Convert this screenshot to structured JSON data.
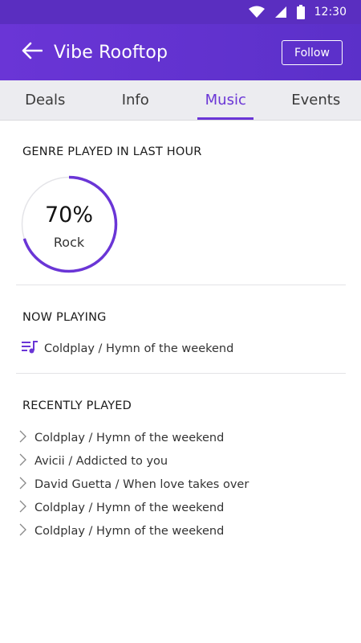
{
  "status_bar": {
    "time": "12:30",
    "icons": [
      "wifi-icon",
      "signal-icon",
      "battery-icon"
    ]
  },
  "app_bar": {
    "title": "Vibe Rooftop",
    "follow_label": "Follow",
    "back_icon": "arrow-left-icon"
  },
  "tabs": [
    {
      "label": "Deals",
      "active": false
    },
    {
      "label": "Info",
      "active": false
    },
    {
      "label": "Music",
      "active": true
    },
    {
      "label": "Events",
      "active": false
    }
  ],
  "genre": {
    "section_title": "GENRE PLAYED IN LAST HOUR",
    "percent_label": "70%",
    "percent": 0.7,
    "genre": "Rock"
  },
  "now_playing": {
    "section_title": "NOW PLAYING",
    "track": "Coldplay / Hymn of the weekend",
    "icon": "queue-music-icon"
  },
  "recently_played": {
    "section_title": "RECENTLY PLAYED",
    "items": [
      "Coldplay /  Hymn of the weekend",
      "Avicii  / Addicted to you",
      "David Guetta / When love takes over",
      "Coldplay / Hymn of the weekend",
      "Coldplay / Hymn of the weekend"
    ]
  },
  "colors": {
    "accent": "#6a35d6",
    "status_bar": "#5a2ec0",
    "tab_bg": "#ececf0"
  }
}
